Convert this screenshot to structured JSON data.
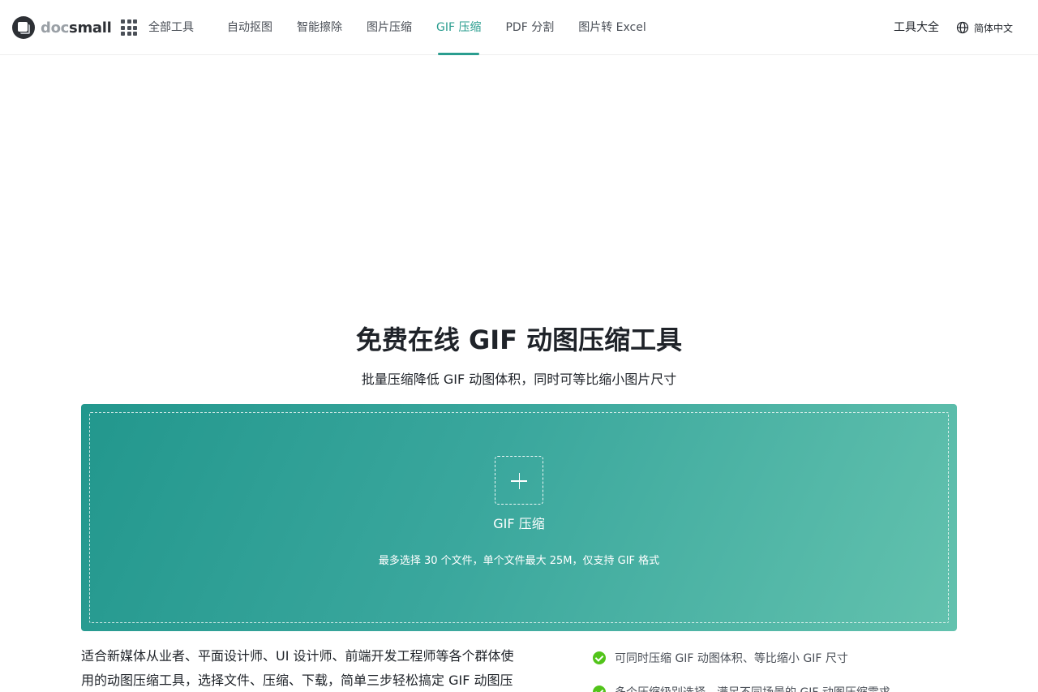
{
  "header": {
    "logo": {
      "part1": "doc",
      "part2": "small"
    },
    "all_tools_label": "全部工具",
    "nav": [
      {
        "label": "自动抠图"
      },
      {
        "label": "智能擦除"
      },
      {
        "label": "图片压缩"
      },
      {
        "label": "GIF 压缩",
        "active": true
      },
      {
        "label": "PDF 分割"
      },
      {
        "label": "图片转 Excel"
      }
    ],
    "tools_all_label": "工具大全",
    "language_label": "简体中文"
  },
  "hero": {
    "title": "免费在线 GIF 动图压缩工具",
    "subtitle": "批量压缩降低 GIF 动图体积，同时可等比缩小图片尺寸"
  },
  "upload": {
    "label": "GIF 压缩",
    "hint": "最多选择 30 个文件，单个文件最大 25M，仅支持 GIF 格式"
  },
  "description": "适合新媒体从业者、平面设计师、UI 设计师、前端开发工程师等各个群体使用的动图压缩工具，选择文件、压缩、下载，简单三步轻松搞定 GIF 动图压",
  "features": [
    {
      "text": "可同时压缩 GIF 动图体积、等比缩小 GIF 尺寸"
    },
    {
      "text": "多个压缩级别选择，满足不同场景的 GIF 动图压缩需求"
    }
  ],
  "colors": {
    "accent": "#2a9d8f",
    "check": "#52c41a",
    "gradient_start": "#22978d",
    "gradient_end": "#63c2ae"
  },
  "icons": {
    "apps": "grid-icon",
    "language": "globe-icon",
    "upload": "plus-icon",
    "feature": "check-circle-icon"
  }
}
